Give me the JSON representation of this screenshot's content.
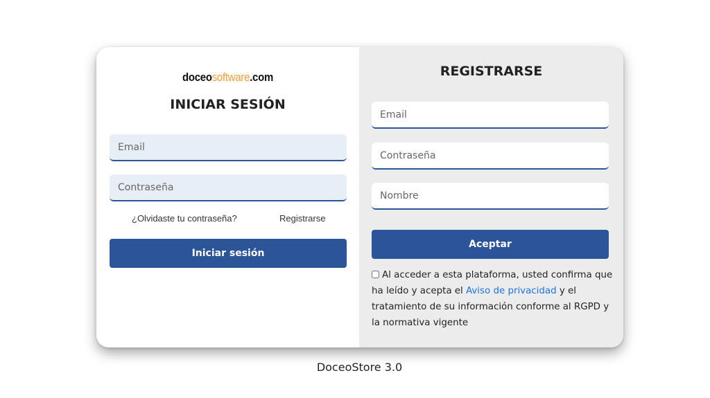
{
  "brand": {
    "logo_part1": "doceo",
    "logo_part2": "software",
    "logo_part3": ".com",
    "orange_color": "#f39c34"
  },
  "login": {
    "title": "INICIAR SESIÓN",
    "email_placeholder": "Email",
    "password_placeholder": "Contraseña",
    "forgot_link": "¿Olvidaste tu contraseña?",
    "register_link": "Registrarse",
    "submit_label": "Iniciar sesión"
  },
  "register": {
    "title": "REGISTRARSE",
    "email_placeholder": "Email",
    "password_placeholder": "Contraseña",
    "name_placeholder": "Nombre",
    "submit_label": "Aceptar",
    "consent_before": "Al acceder a esta plataforma, usted confirma que ha leído y acepta el ",
    "consent_link": "Aviso de privacidad",
    "consent_after": " y el tratamiento de su información conforme al RGPD y la normativa vigente"
  },
  "footer": {
    "version": "DoceoStore 3.0"
  },
  "colors": {
    "primary": "#2c5599",
    "link": "#1a73e8",
    "right_panel_bg": "#ececec",
    "left_input_bg": "#e8eef6"
  }
}
